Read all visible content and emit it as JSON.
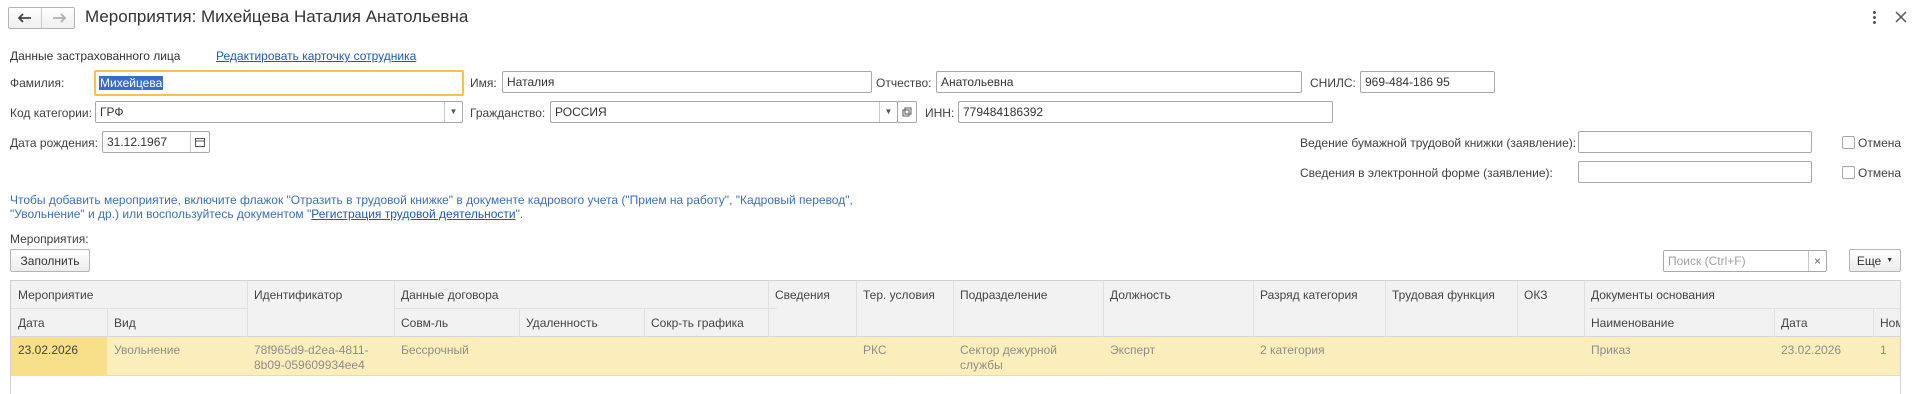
{
  "window": {
    "title": "Мероприятия: Михейцева Наталия Анатольевна",
    "nav_back_icon": "arrow-left-icon",
    "nav_forward_icon": "arrow-right-icon",
    "more_icon": "more-vertical-icon",
    "close_icon": "close-icon"
  },
  "person": {
    "section_label": "Данные застрахованного лица",
    "edit_link": "Редактировать карточку сотрудника",
    "surname_label": "Фамилия:",
    "surname": "Михейцева",
    "name_label": "Имя:",
    "name": "Наталия",
    "patronymic_label": "Отчество:",
    "patronymic": "Анатольевна",
    "snils_label": "СНИЛС:",
    "snils": "969-484-186 95",
    "category_label": "Код категории:",
    "category": "ГРФ",
    "citizenship_label": "Гражданство:",
    "citizenship": "РОССИЯ",
    "inn_label": "ИНН:",
    "inn": "779484186392",
    "birth_label": "Дата рождения:",
    "birth_date": "31.12.1967"
  },
  "statements": {
    "paper_book_label": "Ведение бумажной трудовой книжки (заявление):",
    "paper_book_value": "",
    "electronic_label": "Сведения в электронной форме (заявление):",
    "electronic_value": "",
    "cancel_label": "Отмена"
  },
  "info": {
    "line1": "Чтобы добавить мероприятие, включите флажок \"Отразить в трудовой книжке\" в документе кадрового учета (\"Прием на работу\", \"Кадровый перевод\",",
    "line2_prefix": "\"Увольнение\" и др.) или воспользуйтесь документом \"",
    "line2_link": "Регистрация трудовой деятельности",
    "line2_suffix": "\"."
  },
  "events": {
    "label": "Мероприятия:",
    "fill_button": "Заполнить",
    "search_placeholder": "Поиск (Ctrl+F)",
    "more_button": "Еще"
  },
  "table": {
    "header_top": {
      "event": "Мероприятие",
      "id": "Идентификатор",
      "contract": "Данные договора",
      "info": "Сведения",
      "conditions": "Тер. условия",
      "division": "Подразделение",
      "position": "Должность",
      "grade": "Разряд категория",
      "function": "Трудовая функция",
      "okz": "ОКЗ",
      "docs": "Документы основания"
    },
    "header_bottom": {
      "date": "Дата",
      "kind": "Вид",
      "combo": "Совм-ль",
      "remote": "Удаленность",
      "reduced": "Сокр-ть графика",
      "doc_name": "Наименование",
      "doc_date": "Дата",
      "doc_num": "Ном"
    },
    "rows": [
      {
        "date": "23.02.2026",
        "kind": "Увольнение",
        "id_line1": "78f965d9-d2ea-4811-",
        "id_line2": "8b09-059609934ee4",
        "combo": "Бессрочный",
        "remote": "",
        "reduced": "",
        "info": "",
        "conditions": "РКС",
        "division_line1": "Сектор дежурной",
        "division_line2": "службы",
        "position": "Эксперт",
        "grade": "2 категория",
        "function": "",
        "okz": "",
        "doc_name": "Приказ",
        "doc_date": "23.02.2026",
        "doc_num": "1"
      }
    ]
  }
}
